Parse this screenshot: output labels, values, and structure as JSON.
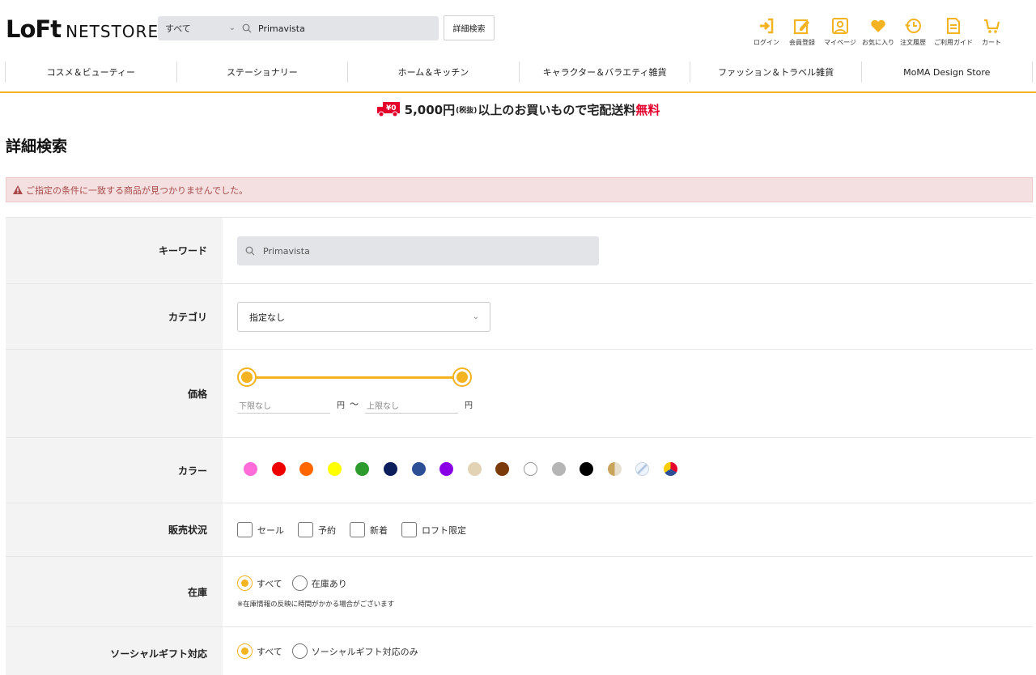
{
  "header": {
    "logo_mark": "LoFt",
    "logo_text": "NETSTORE",
    "search_category": "すべて",
    "search_value": "Primavista",
    "advanced_search_label": "詳細検索",
    "icons": [
      {
        "name": "login-icon",
        "label": "ログイン"
      },
      {
        "name": "register-icon",
        "label": "会員登録"
      },
      {
        "name": "mypage-icon",
        "label": "マイページ"
      },
      {
        "name": "favorite-icon",
        "label": "お気に入り"
      },
      {
        "name": "order-history-icon",
        "label": "注文履歴"
      },
      {
        "name": "guide-icon",
        "label": "ご利用ガイド"
      },
      {
        "name": "cart-icon",
        "label": "カート"
      }
    ],
    "accent_color": "#f4b320"
  },
  "nav": {
    "items": [
      "コスメ＆ビューティー",
      "ステーショナリー",
      "ホーム＆キッチン",
      "キャラクター＆バラエティ雑貨",
      "ファッション＆トラベル雑貨",
      "MoMA Design Store"
    ]
  },
  "banner": {
    "amount": "5,000円",
    "tax": "(税抜)",
    "text": "以上のお買いもので宅配送料",
    "free": "無料"
  },
  "page": {
    "title": "詳細検索",
    "alert": "ご指定の条件に一致する商品が見つかりませんでした。"
  },
  "form": {
    "keyword": {
      "label": "キーワード",
      "value": "Primavista"
    },
    "category": {
      "label": "カテゴリ",
      "value": "指定なし"
    },
    "price": {
      "label": "価格",
      "min_placeholder": "下限なし",
      "max_placeholder": "上限なし",
      "yen": "円",
      "tilde": "～",
      "range_fraction": [
        0,
        1
      ]
    },
    "color": {
      "label": "カラー",
      "swatches": [
        "#ff6bd8",
        "#ee0000",
        "#ff6600",
        "#ffff00",
        "#2e9b2e",
        "#0c1f5c",
        "#2d4f95",
        "#8a00e6",
        "#e2d3b4",
        "#7a3a0a",
        "#ffffff",
        "#b5b5b5",
        "#000000",
        "gold",
        "clear",
        "multi"
      ]
    },
    "status": {
      "label": "販売状況",
      "options": [
        "セール",
        "予約",
        "新着",
        "ロフト限定"
      ]
    },
    "stock": {
      "label": "在庫",
      "options": [
        "すべて",
        "在庫あり"
      ],
      "selected": "すべて",
      "note": "※在庫情報の反映に時間がかかる場合がございます"
    },
    "social_gift": {
      "label": "ソーシャルギフト対応",
      "options": [
        "すべて",
        "ソーシャルギフト対応のみ"
      ],
      "selected": "すべて"
    }
  }
}
